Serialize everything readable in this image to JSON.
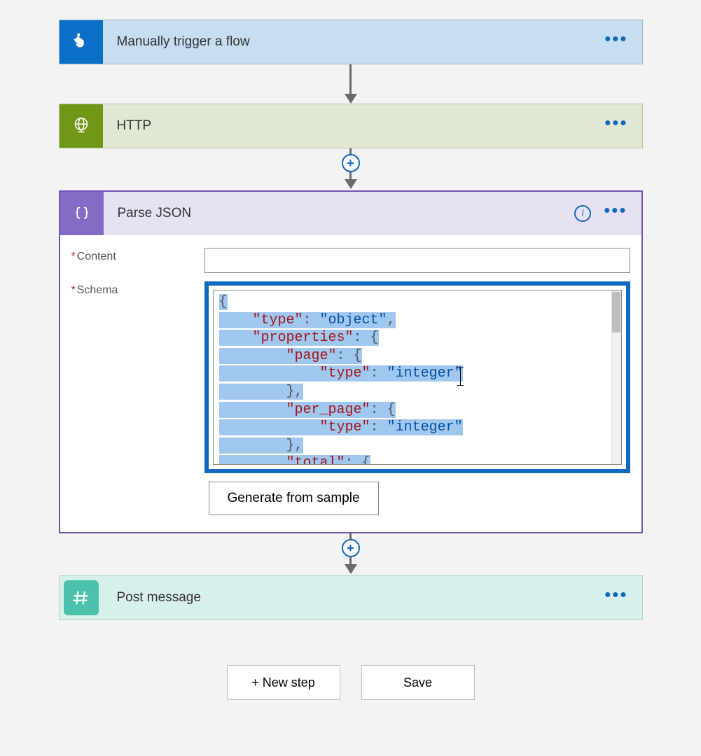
{
  "steps": {
    "trigger": {
      "title": "Manually trigger a flow"
    },
    "http": {
      "title": "HTTP"
    },
    "parse": {
      "title": "Parse JSON"
    },
    "post": {
      "title": "Post message"
    }
  },
  "parse_panel": {
    "content_label": "Content",
    "schema_label": "Schema",
    "generate_button": "Generate from sample",
    "schema_lines": [
      {
        "indent": 0,
        "tokens": [
          {
            "t": "{",
            "c": "p"
          }
        ]
      },
      {
        "indent": 1,
        "tokens": [
          {
            "t": "\"type\"",
            "c": "k"
          },
          {
            "t": ": ",
            "c": "p"
          },
          {
            "t": "\"object\"",
            "c": "s"
          },
          {
            "t": ",",
            "c": "p"
          }
        ]
      },
      {
        "indent": 1,
        "tokens": [
          {
            "t": "\"properties\"",
            "c": "k"
          },
          {
            "t": ": {",
            "c": "p"
          }
        ]
      },
      {
        "indent": 2,
        "tokens": [
          {
            "t": "\"page\"",
            "c": "k"
          },
          {
            "t": ": {",
            "c": "p"
          }
        ]
      },
      {
        "indent": 3,
        "tokens": [
          {
            "t": "\"type\"",
            "c": "k"
          },
          {
            "t": ": ",
            "c": "p"
          },
          {
            "t": "\"integer\"",
            "c": "s"
          }
        ]
      },
      {
        "indent": 2,
        "tokens": [
          {
            "t": "},",
            "c": "p"
          }
        ]
      },
      {
        "indent": 2,
        "tokens": [
          {
            "t": "\"per_page\"",
            "c": "k"
          },
          {
            "t": ": {",
            "c": "p"
          }
        ]
      },
      {
        "indent": 3,
        "tokens": [
          {
            "t": "\"type\"",
            "c": "k"
          },
          {
            "t": ": ",
            "c": "p"
          },
          {
            "t": "\"integer\"",
            "c": "s"
          }
        ]
      },
      {
        "indent": 2,
        "tokens": [
          {
            "t": "},",
            "c": "p"
          }
        ]
      },
      {
        "indent": 2,
        "tokens": [
          {
            "t": "\"total\"",
            "c": "k"
          },
          {
            "t": ": {",
            "c": "p"
          }
        ]
      }
    ]
  },
  "footer": {
    "new_step": "+ New step",
    "save": "Save"
  }
}
